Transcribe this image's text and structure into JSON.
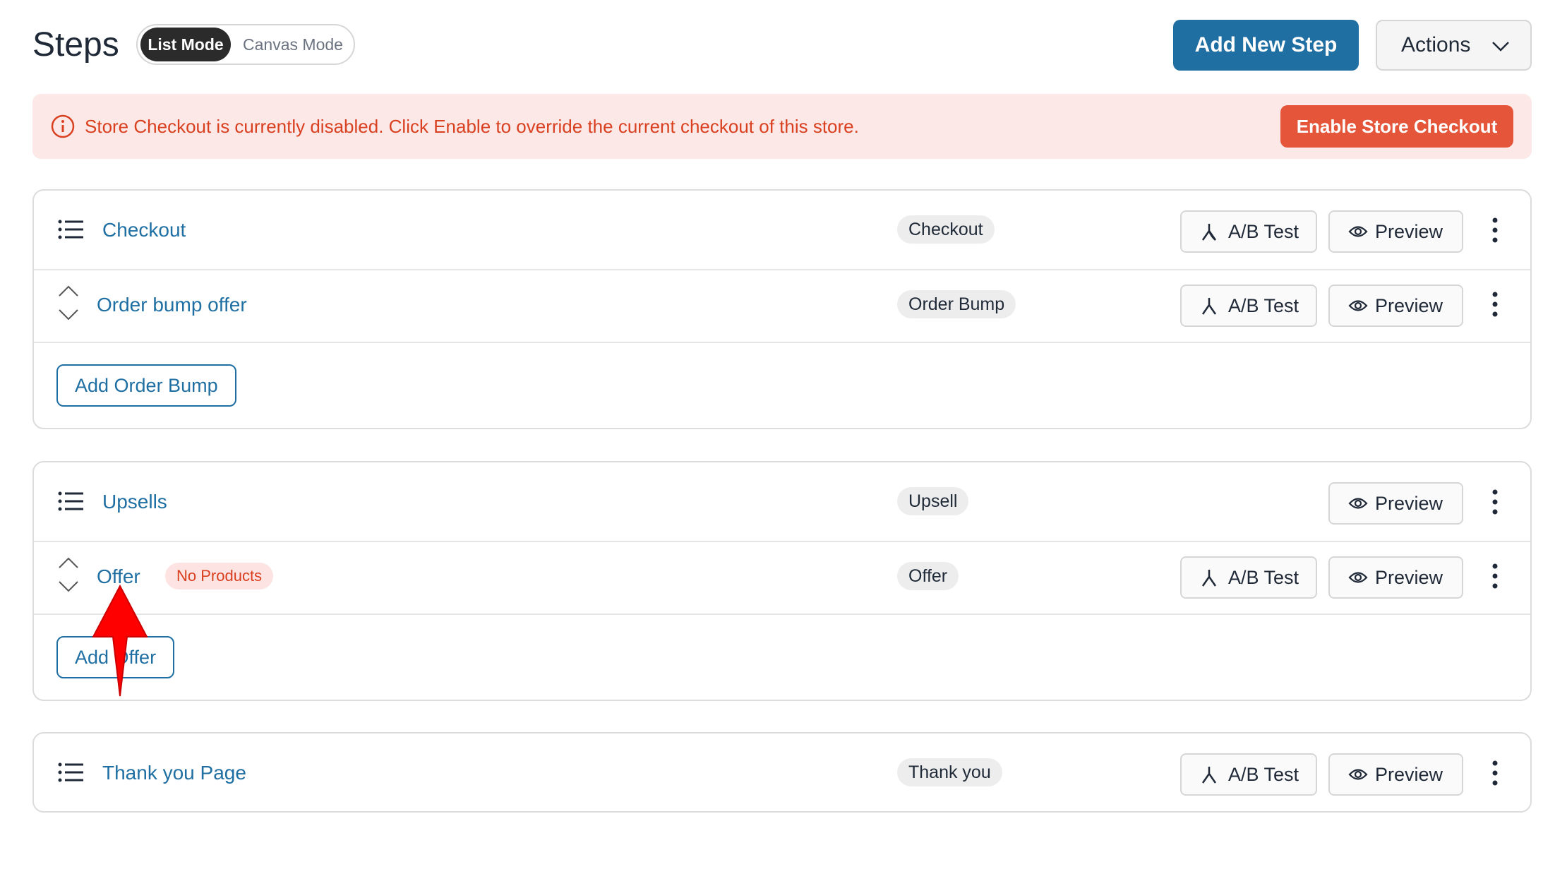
{
  "header": {
    "title": "Steps",
    "modes": {
      "active": "List Mode",
      "inactive": "Canvas Mode"
    },
    "add_new_step_label": "Add New Step",
    "actions_label": "Actions"
  },
  "notice": {
    "message": "Store Checkout is currently disabled. Click Enable to override the current checkout of this store.",
    "enable_label": "Enable Store Checkout"
  },
  "buttons": {
    "ab_test": "A/B Test",
    "preview": "Preview"
  },
  "groups": {
    "checkout": {
      "name": "Checkout",
      "type": "Checkout",
      "sub_name": "Order bump offer",
      "sub_type": "Order Bump",
      "add_label": "Add Order Bump"
    },
    "upsells": {
      "name": "Upsells",
      "type": "Upsell",
      "sub_name": "Offer",
      "sub_badge": "No Products",
      "sub_type": "Offer",
      "add_label": "Add Offer"
    },
    "thankyou": {
      "name": "Thank you Page",
      "type": "Thank you"
    }
  },
  "colors": {
    "primary": "#1f6fa3",
    "danger": "#e4553a",
    "notice_bg": "#fde8e8",
    "annotation_arrow": "#ff0000"
  }
}
